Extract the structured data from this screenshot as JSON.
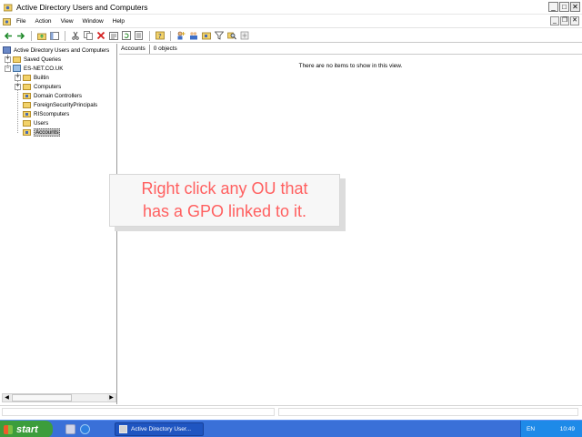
{
  "window": {
    "title": "Active Directory Users and Computers",
    "buttons": {
      "minimize": "_",
      "maximize": "□",
      "close": "✕"
    }
  },
  "menubar": {
    "items": [
      "File",
      "Action",
      "View",
      "Window",
      "Help"
    ],
    "mdi_buttons": {
      "minimize": "_",
      "restore": "❐",
      "close": "✕"
    }
  },
  "toolbar": {
    "icons": [
      "back-icon",
      "forward-icon",
      "up-icon",
      "show-hide-tree-icon",
      "cut-icon",
      "copy-icon",
      "delete-icon",
      "properties-icon",
      "refresh-icon",
      "export-list-icon",
      "help-icon",
      "create-user-icon",
      "create-group-icon",
      "create-ou-icon",
      "filter-icon",
      "find-icon",
      "add-to-group-icon"
    ]
  },
  "tree": {
    "root": "Active Directory Users and Computers",
    "saved_queries": "Saved Queries",
    "domain": "ES-NET.CO.UK",
    "children": [
      "Builtin",
      "Computers",
      "Domain Controllers",
      "ForeignSecurityPrincipals",
      "RIScomputers",
      "Users",
      "Accounts"
    ],
    "selected": "Accounts"
  },
  "detail": {
    "header_path": "Accounts",
    "header_count": "0 objects",
    "empty_message": "There are no items to show in this view."
  },
  "callout": {
    "line1": "Right click any OU that",
    "line2": "has a GPO linked to it."
  },
  "taskbar": {
    "start_label": "start",
    "task_label": "Active Directory User...",
    "language": "EN",
    "clock": "10:49"
  },
  "colors": {
    "callout_text": "#ff5f5f",
    "taskbar_blue": "#3a70d8",
    "start_green": "#3c9d3c",
    "tray_blue": "#1e8ae8"
  }
}
